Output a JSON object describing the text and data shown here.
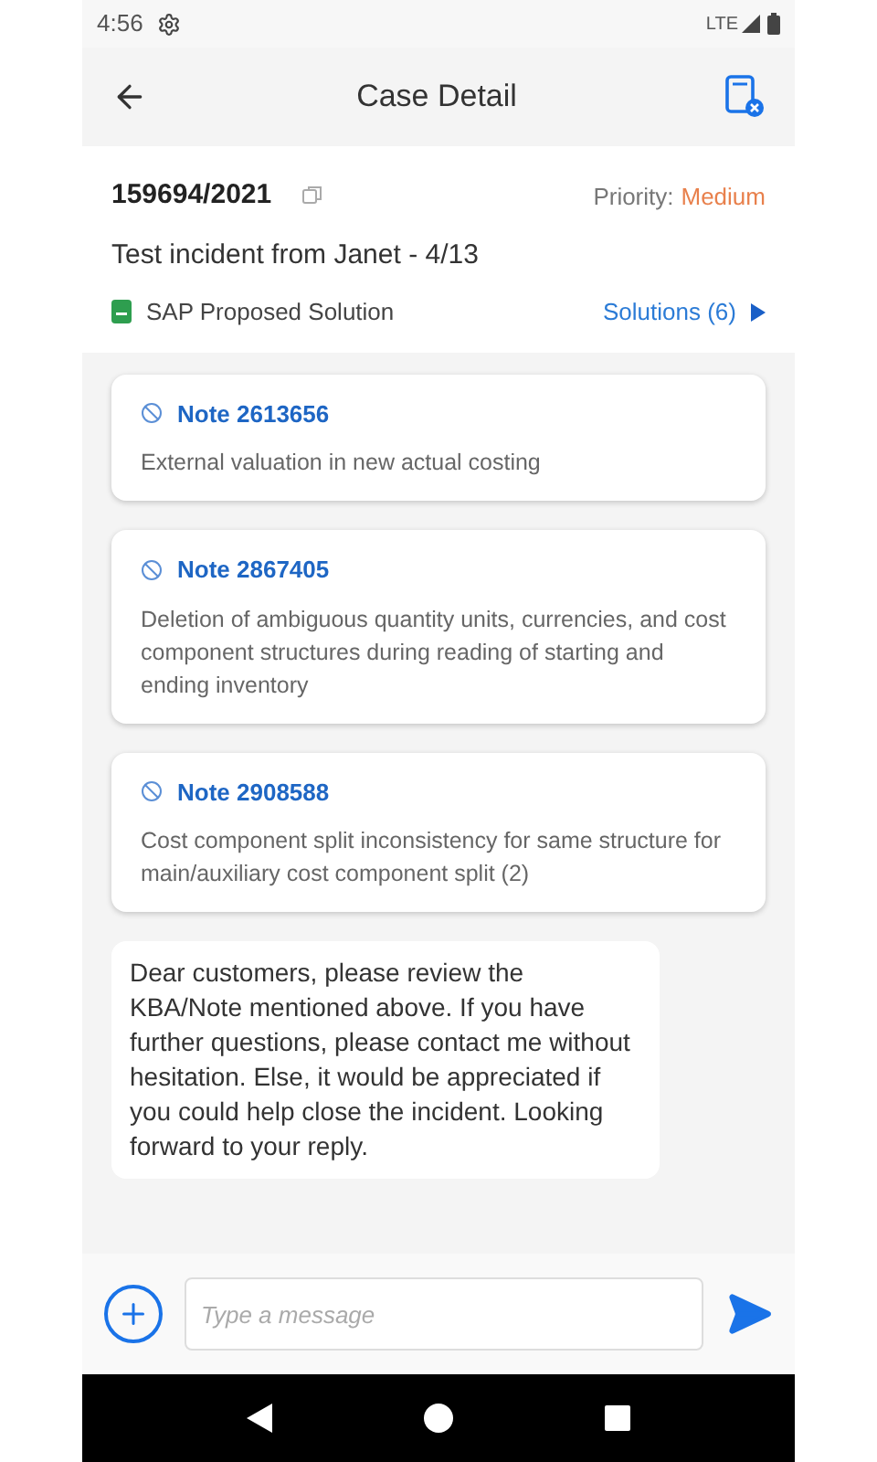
{
  "status_bar": {
    "time": "4:56",
    "network": "LTE"
  },
  "header": {
    "title": "Case Detail"
  },
  "case": {
    "number": "159694/2021",
    "priority_label": "Priority:",
    "priority_value": "Medium",
    "title": "Test incident from Janet - 4/13",
    "solution_label": "SAP Proposed Solution",
    "solutions_link": "Solutions (6)"
  },
  "notes": [
    {
      "title": "Note 2613656",
      "description": "External valuation in new actual costing"
    },
    {
      "title": "Note 2867405",
      "description": "Deletion of ambiguous quantity units, currencies, and cost component structures during reading of starting and ending inventory"
    },
    {
      "title": "Note 2908588",
      "description": "Cost component split inconsistency for same structure for main/auxiliary cost component split (2)"
    }
  ],
  "message": "Dear customers, please review the KBA/Note mentioned above. If you have further questions, please contact me without hesitation. Else, it would be appreciated if you could help close the incident. Looking forward to your reply.",
  "composer": {
    "placeholder": "Type a message"
  }
}
